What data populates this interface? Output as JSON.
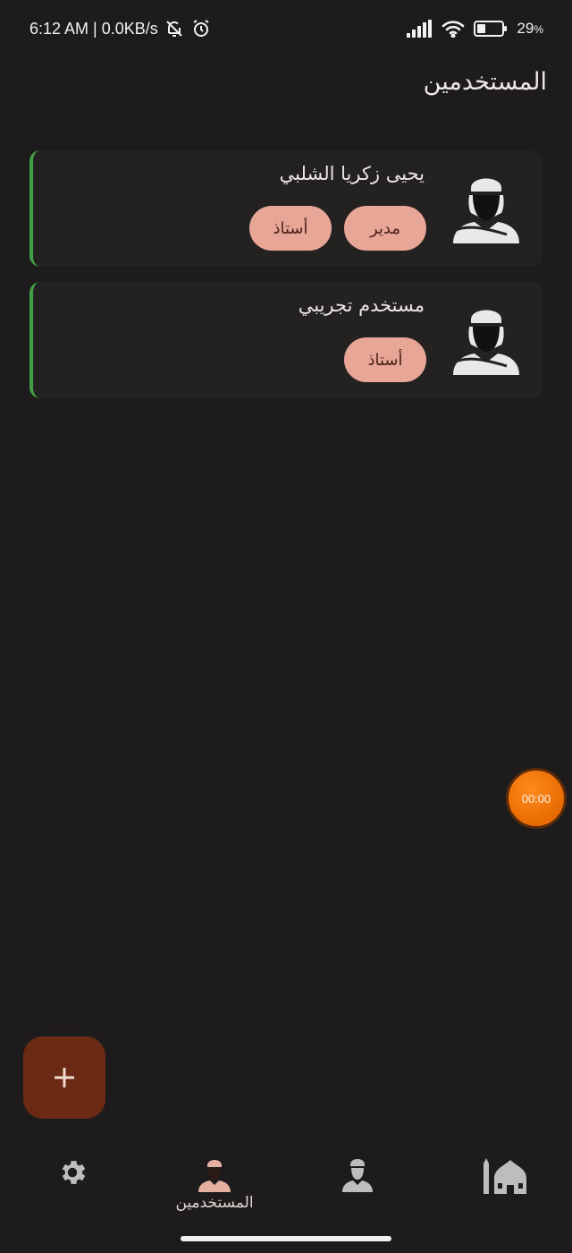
{
  "status_bar": {
    "time_speed": "6:12 AM | 0.0KB/s",
    "battery_percent": "29",
    "battery_unit": "%"
  },
  "page": {
    "title": "المستخدمين"
  },
  "users": [
    {
      "name": "يحيى زكريا الشلبي",
      "roles": [
        "مدير",
        "أستاذ"
      ],
      "accent": "#43a047"
    },
    {
      "name": "مستخدم تجريبي",
      "roles": [
        "أستاذ"
      ],
      "accent": "#43a047"
    }
  ],
  "timer": {
    "label": "00:00",
    "color": "#ff7a0a"
  },
  "fab": {
    "label": "+",
    "color": "#6b2a14"
  },
  "bottom_nav": {
    "items": [
      {
        "icon": "gear-icon",
        "label": ""
      },
      {
        "icon": "user-icon",
        "label": "المستخدمين",
        "active": true
      },
      {
        "icon": "teacher-icon",
        "label": ""
      },
      {
        "icon": "mosque-icon",
        "label": ""
      }
    ]
  },
  "colors": {
    "background": "#1d1b1b",
    "card": "#242121",
    "chip": "#e8a796",
    "chip_text": "#4a2118"
  }
}
